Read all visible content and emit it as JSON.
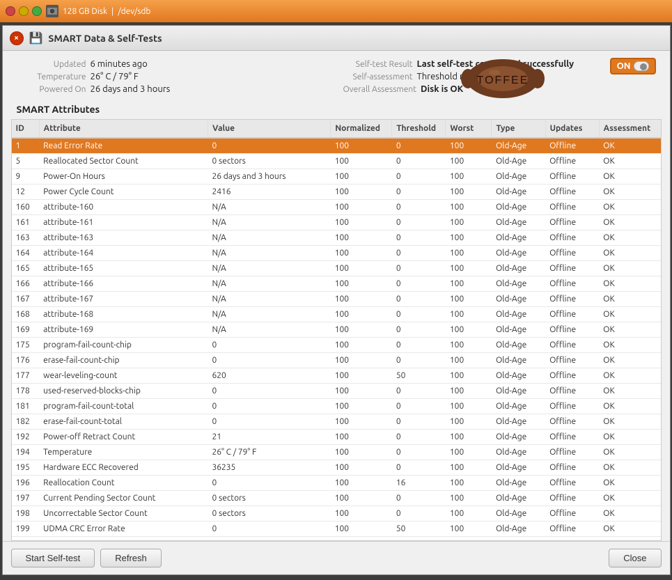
{
  "titlebar": {
    "disk_label": "128 GB Disk",
    "dev_label": "/dev/sdb"
  },
  "window": {
    "title": "SMART Data & Self-Tests",
    "close_label": "×"
  },
  "info": {
    "updated_label": "Updated",
    "updated_value": "6 minutes ago",
    "temperature_label": "Temperature",
    "temperature_value": "26° C / 79° F",
    "powered_on_label": "Powered On",
    "powered_on_value": "26 days and 3 hours",
    "self_test_label": "Self-test Result",
    "self_test_value": "Last self-test completed successfully",
    "self_assess_label": "Self-assessment",
    "self_assess_value": "Threshold not exceeded",
    "overall_label": "Overall Assessment",
    "overall_value": "Disk is OK",
    "toggle_label": "ON"
  },
  "smart_heading": "SMART Attributes",
  "table": {
    "columns": [
      "ID",
      "Attribute",
      "Value",
      "Normalized",
      "Threshold",
      "Worst",
      "Type",
      "Updates",
      "Assessment"
    ],
    "rows": [
      {
        "id": "1",
        "attr": "Read Error Rate",
        "value": "0",
        "norm": "100",
        "thresh": "0",
        "worst": "100",
        "type": "Old-Age",
        "updates": "Offline",
        "assess": "OK",
        "selected": true
      },
      {
        "id": "5",
        "attr": "Reallocated Sector Count",
        "value": "0 sectors",
        "norm": "100",
        "thresh": "0",
        "worst": "100",
        "type": "Old-Age",
        "updates": "Offline",
        "assess": "OK",
        "selected": false
      },
      {
        "id": "9",
        "attr": "Power-On Hours",
        "value": "26 days and 3 hours",
        "norm": "100",
        "thresh": "0",
        "worst": "100",
        "type": "Old-Age",
        "updates": "Offline",
        "assess": "OK",
        "selected": false
      },
      {
        "id": "12",
        "attr": "Power Cycle Count",
        "value": "2416",
        "norm": "100",
        "thresh": "0",
        "worst": "100",
        "type": "Old-Age",
        "updates": "Offline",
        "assess": "OK",
        "selected": false
      },
      {
        "id": "160",
        "attr": "attribute-160",
        "value": "N/A",
        "norm": "100",
        "thresh": "0",
        "worst": "100",
        "type": "Old-Age",
        "updates": "Offline",
        "assess": "OK",
        "selected": false
      },
      {
        "id": "161",
        "attr": "attribute-161",
        "value": "N/A",
        "norm": "100",
        "thresh": "0",
        "worst": "100",
        "type": "Old-Age",
        "updates": "Offline",
        "assess": "OK",
        "selected": false
      },
      {
        "id": "163",
        "attr": "attribute-163",
        "value": "N/A",
        "norm": "100",
        "thresh": "0",
        "worst": "100",
        "type": "Old-Age",
        "updates": "Offline",
        "assess": "OK",
        "selected": false
      },
      {
        "id": "164",
        "attr": "attribute-164",
        "value": "N/A",
        "norm": "100",
        "thresh": "0",
        "worst": "100",
        "type": "Old-Age",
        "updates": "Offline",
        "assess": "OK",
        "selected": false
      },
      {
        "id": "165",
        "attr": "attribute-165",
        "value": "N/A",
        "norm": "100",
        "thresh": "0",
        "worst": "100",
        "type": "Old-Age",
        "updates": "Offline",
        "assess": "OK",
        "selected": false
      },
      {
        "id": "166",
        "attr": "attribute-166",
        "value": "N/A",
        "norm": "100",
        "thresh": "0",
        "worst": "100",
        "type": "Old-Age",
        "updates": "Offline",
        "assess": "OK",
        "selected": false
      },
      {
        "id": "167",
        "attr": "attribute-167",
        "value": "N/A",
        "norm": "100",
        "thresh": "0",
        "worst": "100",
        "type": "Old-Age",
        "updates": "Offline",
        "assess": "OK",
        "selected": false
      },
      {
        "id": "168",
        "attr": "attribute-168",
        "value": "N/A",
        "norm": "100",
        "thresh": "0",
        "worst": "100",
        "type": "Old-Age",
        "updates": "Offline",
        "assess": "OK",
        "selected": false
      },
      {
        "id": "169",
        "attr": "attribute-169",
        "value": "N/A",
        "norm": "100",
        "thresh": "0",
        "worst": "100",
        "type": "Old-Age",
        "updates": "Offline",
        "assess": "OK",
        "selected": false
      },
      {
        "id": "175",
        "attr": "program-fail-count-chip",
        "value": "0",
        "norm": "100",
        "thresh": "0",
        "worst": "100",
        "type": "Old-Age",
        "updates": "Offline",
        "assess": "OK",
        "selected": false
      },
      {
        "id": "176",
        "attr": "erase-fail-count-chip",
        "value": "0",
        "norm": "100",
        "thresh": "0",
        "worst": "100",
        "type": "Old-Age",
        "updates": "Offline",
        "assess": "OK",
        "selected": false
      },
      {
        "id": "177",
        "attr": "wear-leveling-count",
        "value": "620",
        "norm": "100",
        "thresh": "50",
        "worst": "100",
        "type": "Old-Age",
        "updates": "Offline",
        "assess": "OK",
        "selected": false
      },
      {
        "id": "178",
        "attr": "used-reserved-blocks-chip",
        "value": "0",
        "norm": "100",
        "thresh": "0",
        "worst": "100",
        "type": "Old-Age",
        "updates": "Offline",
        "assess": "OK",
        "selected": false
      },
      {
        "id": "181",
        "attr": "program-fail-count-total",
        "value": "0",
        "norm": "100",
        "thresh": "0",
        "worst": "100",
        "type": "Old-Age",
        "updates": "Offline",
        "assess": "OK",
        "selected": false
      },
      {
        "id": "182",
        "attr": "erase-fail-count-total",
        "value": "0",
        "norm": "100",
        "thresh": "0",
        "worst": "100",
        "type": "Old-Age",
        "updates": "Offline",
        "assess": "OK",
        "selected": false
      },
      {
        "id": "192",
        "attr": "Power-off Retract Count",
        "value": "21",
        "norm": "100",
        "thresh": "0",
        "worst": "100",
        "type": "Old-Age",
        "updates": "Offline",
        "assess": "OK",
        "selected": false
      },
      {
        "id": "194",
        "attr": "Temperature",
        "value": "26° C / 79° F",
        "norm": "100",
        "thresh": "0",
        "worst": "100",
        "type": "Old-Age",
        "updates": "Offline",
        "assess": "OK",
        "selected": false
      },
      {
        "id": "195",
        "attr": "Hardware ECC Recovered",
        "value": "36235",
        "norm": "100",
        "thresh": "0",
        "worst": "100",
        "type": "Old-Age",
        "updates": "Offline",
        "assess": "OK",
        "selected": false
      },
      {
        "id": "196",
        "attr": "Reallocation Count",
        "value": "0",
        "norm": "100",
        "thresh": "16",
        "worst": "100",
        "type": "Old-Age",
        "updates": "Offline",
        "assess": "OK",
        "selected": false
      },
      {
        "id": "197",
        "attr": "Current Pending Sector Count",
        "value": "0 sectors",
        "norm": "100",
        "thresh": "0",
        "worst": "100",
        "type": "Old-Age",
        "updates": "Offline",
        "assess": "OK",
        "selected": false
      },
      {
        "id": "198",
        "attr": "Uncorrectable Sector Count",
        "value": "0 sectors",
        "norm": "100",
        "thresh": "0",
        "worst": "100",
        "type": "Old-Age",
        "updates": "Offline",
        "assess": "OK",
        "selected": false
      },
      {
        "id": "199",
        "attr": "UDMA CRC Error Rate",
        "value": "0",
        "norm": "100",
        "thresh": "50",
        "worst": "100",
        "type": "Old-Age",
        "updates": "Offline",
        "assess": "OK",
        "selected": false
      }
    ]
  },
  "buttons": {
    "start_self_test": "Start Self-test",
    "refresh": "Refresh",
    "close": "Close"
  }
}
